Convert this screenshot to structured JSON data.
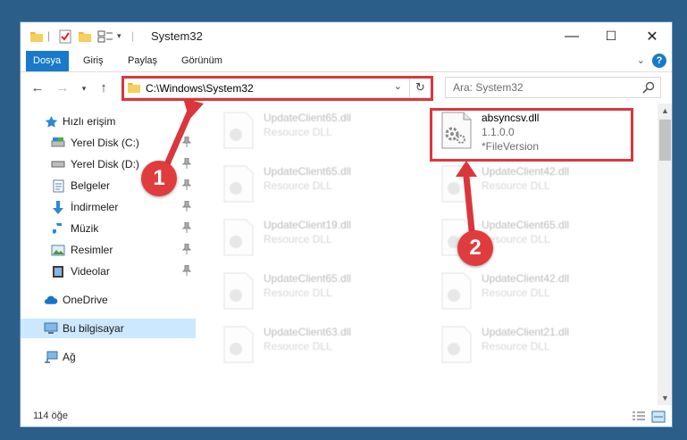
{
  "window": {
    "title": "System32",
    "minimize": "—",
    "maximize": "☐",
    "close": "✕"
  },
  "ribbon": {
    "tabs": [
      {
        "label": "Dosya",
        "active": true
      },
      {
        "label": "Giriş"
      },
      {
        "label": "Paylaş"
      },
      {
        "label": "Görünüm"
      }
    ],
    "help": "?"
  },
  "nav": {
    "address": "C:\\Windows\\System32",
    "search_placeholder": "Ara: System32"
  },
  "sidebar": {
    "items": [
      {
        "label": "Hızlı erişim",
        "icon": "star-icon"
      },
      {
        "label": "Yerel Disk (C:)",
        "icon": "drive-icon",
        "pinned": true
      },
      {
        "label": "Yerel Disk (D:)",
        "icon": "drive-icon",
        "pinned": true
      },
      {
        "label": "Belgeler",
        "icon": "documents-icon",
        "pinned": true
      },
      {
        "label": "İndirmeler",
        "icon": "download-icon",
        "pinned": true
      },
      {
        "label": "Müzik",
        "icon": "music-icon",
        "pinned": true
      },
      {
        "label": "Resimler",
        "icon": "pictures-icon",
        "pinned": true
      },
      {
        "label": "Videolar",
        "icon": "videos-icon",
        "pinned": true
      },
      {
        "label": "OneDrive",
        "icon": "cloud-icon"
      },
      {
        "label": "Bu bilgisayar",
        "icon": "computer-icon",
        "selected": true
      },
      {
        "label": "Ağ",
        "icon": "network-icon"
      }
    ]
  },
  "files": {
    "left": [
      {
        "name": "UpdateClient65.dll",
        "desc": "Resource DLL"
      },
      {
        "name": "UpdateClient65.dll",
        "desc": "Resource DLL"
      },
      {
        "name": "UpdateClient19.dll",
        "desc": "Resource DLL"
      },
      {
        "name": "UpdateClient65.dll",
        "desc": "Resource DLL"
      },
      {
        "name": "UpdateClient63.dll",
        "desc": "Resource DLL"
      }
    ],
    "highlight": {
      "name": "absyncsv.dll",
      "version": "1.1.0.0",
      "extra": "*FileVersion"
    },
    "right": [
      {
        "name": "UpdateClient42.dll",
        "desc": "Resource DLL"
      },
      {
        "name": "UpdateClient65.dll",
        "desc": "Resource DLL"
      },
      {
        "name": "UpdateClient42.dll",
        "desc": "Resource DLL"
      },
      {
        "name": "UpdateClient21.dll",
        "desc": "Resource DLL"
      }
    ]
  },
  "status": {
    "count": "114 öğe"
  },
  "annotations": {
    "step1": "1",
    "step2": "2",
    "color": "#d9373d"
  }
}
